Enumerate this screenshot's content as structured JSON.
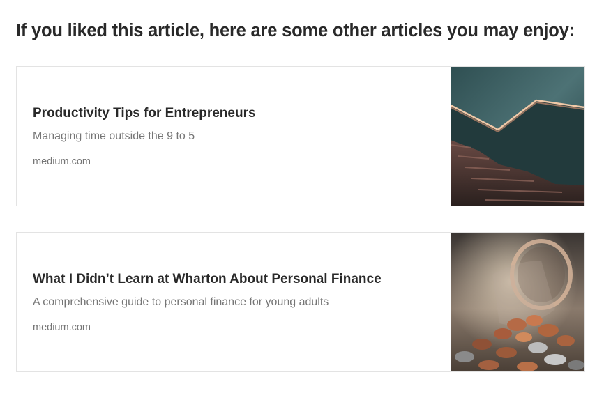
{
  "heading": "If you liked this article, here are some other articles you may enjoy:",
  "articles": [
    {
      "title": "Productivity Tips for Entrepreneurs",
      "subtitle": "Managing time outside the 9 to 5",
      "domain": "medium.com",
      "thumbnail": "staircase-image"
    },
    {
      "title": "What I Didn’t Learn at Wharton About Personal Finance",
      "subtitle": "A comprehensive guide to personal finance for young adults",
      "domain": "medium.com",
      "thumbnail": "coin-jar-image"
    }
  ]
}
